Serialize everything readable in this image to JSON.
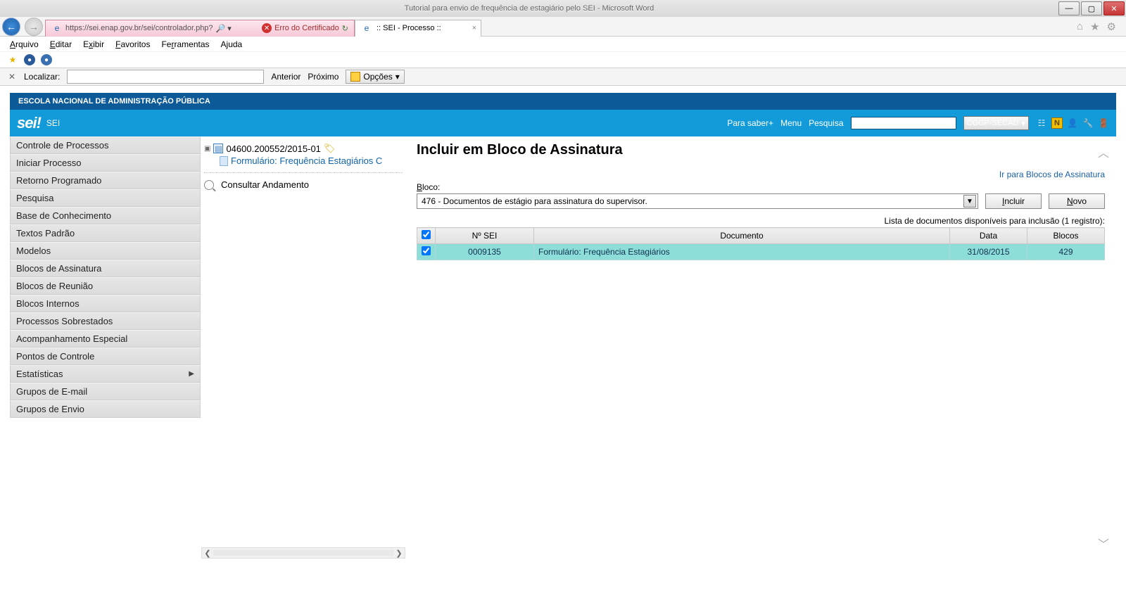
{
  "window": {
    "titlebar_text": "Tutorial para envio de frequência de estagiário pelo SEI - Microsoft Word"
  },
  "browser": {
    "url_text": "https://sei.enap.gov.br/sei/controlador.php?",
    "cert_error": "Erro do Certificado",
    "tab_title": ":: SEI - Processo ::",
    "menus": [
      {
        "pre": "",
        "mn": "A",
        "post": "rquivo"
      },
      {
        "pre": "",
        "mn": "E",
        "post": "ditar"
      },
      {
        "pre": "E",
        "mn": "x",
        "post": "ibir"
      },
      {
        "pre": "",
        "mn": "F",
        "post": "avoritos"
      },
      {
        "pre": "Fe",
        "mn": "r",
        "post": "ramentas"
      },
      {
        "pre": "A",
        "mn": "j",
        "post": "uda"
      }
    ],
    "find_label": "Localizar:",
    "prev_label": "Anterior",
    "next_label": "Próximo",
    "options_label": "Opções"
  },
  "sei": {
    "org_name": "ESCOLA NACIONAL DE ADMINISTRAÇÃO PÚBLICA",
    "logo_text": "sei!",
    "sub": "SEI",
    "links": {
      "saber": "Para saber+",
      "menu": "Menu",
      "pesquisa": "Pesquisa"
    },
    "unit": "CGGP-SECAD"
  },
  "sidebar": {
    "items": [
      {
        "label": "Controle de Processos",
        "arrow": false
      },
      {
        "label": "Iniciar Processo",
        "arrow": false
      },
      {
        "label": "Retorno Programado",
        "arrow": false
      },
      {
        "label": "Pesquisa",
        "arrow": false
      },
      {
        "label": "Base de Conhecimento",
        "arrow": false
      },
      {
        "label": "Textos Padrão",
        "arrow": false
      },
      {
        "label": "Modelos",
        "arrow": false
      },
      {
        "label": "Blocos de Assinatura",
        "arrow": false
      },
      {
        "label": "Blocos de Reunião",
        "arrow": false
      },
      {
        "label": "Blocos Internos",
        "arrow": false
      },
      {
        "label": "Processos Sobrestados",
        "arrow": false
      },
      {
        "label": "Acompanhamento Especial",
        "arrow": false
      },
      {
        "label": "Pontos de Controle",
        "arrow": false
      },
      {
        "label": "Estatísticas",
        "arrow": true
      },
      {
        "label": "Grupos de E-mail",
        "arrow": false
      },
      {
        "label": "Grupos de Envio",
        "arrow": false
      }
    ]
  },
  "tree": {
    "process_number": "04600.200552/2015-01",
    "doc_label": "Formulário: Frequência Estagiários C",
    "consultar": "Consultar Andamento"
  },
  "content": {
    "title": "Incluir em Bloco de Assinatura",
    "right_link": "Ir para Blocos de Assinatura",
    "bloco_label_mn": "B",
    "bloco_label_rest": "loco:",
    "select_value": "476 - Documentos de estágio para assinatura do supervisor.",
    "btn_incluir_mn": "I",
    "btn_incluir_rest": "ncluir",
    "btn_novo_pre": "",
    "btn_novo_mn": "N",
    "btn_novo_rest": "ovo",
    "list_caption": "Lista de documentos disponíveis para inclusão (1 registro):",
    "headers": {
      "nsei": "Nº SEI",
      "doc": "Documento",
      "data": "Data",
      "blocos": "Blocos"
    },
    "row": {
      "nsei": "0009135",
      "doc": "Formulário: Frequência Estagiários",
      "data": "31/08/2015",
      "blocos": "429"
    }
  }
}
